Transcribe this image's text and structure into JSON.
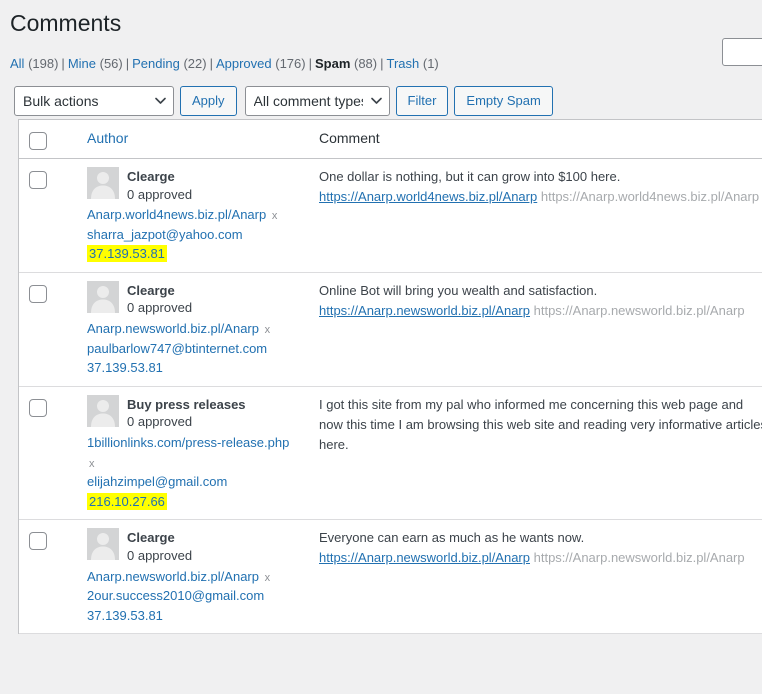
{
  "page": {
    "title": "Comments"
  },
  "filters": [
    {
      "label": "All",
      "count": "(198)",
      "current": false
    },
    {
      "label": "Mine",
      "count": "(56)",
      "current": false
    },
    {
      "label": "Pending",
      "count": "(22)",
      "current": false
    },
    {
      "label": "Approved",
      "count": "(176)",
      "current": false
    },
    {
      "label": "Spam",
      "count": "(88)",
      "current": true
    },
    {
      "label": "Trash",
      "count": "(1)",
      "current": false
    }
  ],
  "search": {
    "value": "",
    "placeholder": ""
  },
  "toolbar": {
    "bulk_actions_selected": "Bulk actions",
    "bulk_actions_options": [
      "Bulk actions"
    ],
    "apply_label": "Apply",
    "comment_types_selected": "All comment types",
    "comment_types_options": [
      "All comment types"
    ],
    "filter_label": "Filter",
    "empty_spam_label": "Empty Spam"
  },
  "table": {
    "columns": {
      "author": "Author",
      "comment": "Comment"
    },
    "rows": [
      {
        "author_name": "Clearge",
        "approved": "0 approved",
        "site_url": "Anarp.world4news.biz.pl/Anarp",
        "delete_label": "x",
        "email": "sharra_jazpot@yahoo.com",
        "ip": "37.139.53.81",
        "ip_highlighted": true,
        "comment_text": "One dollar is nothing, but it can grow into $100 here. ",
        "comment_link": "https://Anarp.world4news.biz.pl/Anarp",
        "comment_plain_url": "https://Anarp.world4news.biz.pl/Anarp"
      },
      {
        "author_name": "Clearge",
        "approved": "0 approved",
        "site_url": "Anarp.newsworld.biz.pl/Anarp",
        "delete_label": "x",
        "email": "paulbarlow747@btinternet.com",
        "ip": "37.139.53.81",
        "ip_highlighted": false,
        "comment_text": "Online Bot will bring you wealth and satisfaction. ",
        "comment_link": "https://Anarp.newsworld.biz.pl/Anarp",
        "comment_plain_url": "https://Anarp.newsworld.biz.pl/Anarp"
      },
      {
        "author_name": "Buy press releases",
        "approved": "0 approved",
        "site_url": "1billionlinks.com/press-release.php",
        "delete_label": "x",
        "email": "elijahzimpel@gmail.com",
        "ip": "216.10.27.66",
        "ip_highlighted": true,
        "comment_text": "I got this site from my pal who informed me concerning this web page and now this time I am browsing this web site and reading very informative articles here.",
        "comment_link": "",
        "comment_plain_url": ""
      },
      {
        "author_name": "Clearge",
        "approved": "0 approved",
        "site_url": "Anarp.newsworld.biz.pl/Anarp",
        "delete_label": "x",
        "email": "2our.success2010@gmail.com",
        "ip": "37.139.53.81",
        "ip_highlighted": false,
        "comment_text": "Everyone can earn as much as he wants now. ",
        "comment_link": "https://Anarp.newsworld.biz.pl/Anarp",
        "comment_plain_url": "https://Anarp.newsworld.biz.pl/Anarp"
      }
    ]
  },
  "colors": {
    "link": "#2271b1",
    "highlight": "#ffff00",
    "text": "#3c434a",
    "muted": "#a7aaad",
    "page_bg": "#f0f0f1"
  }
}
